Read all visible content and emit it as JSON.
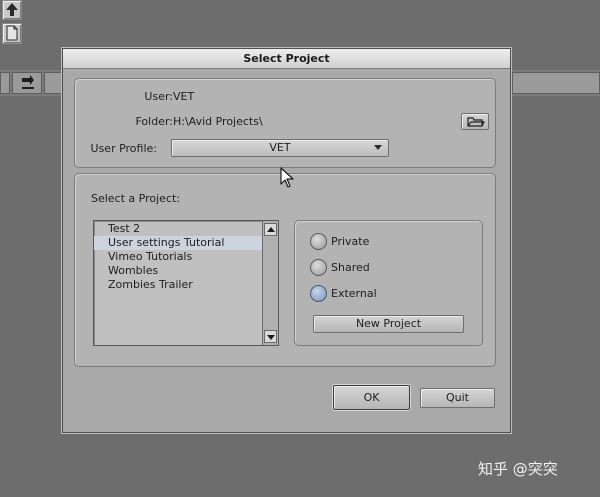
{
  "dialog": {
    "title": "Select Project",
    "user_label": "User:",
    "user_value": "VET",
    "folder_label": "Folder:",
    "folder_value": "H:\\Avid Projects\\",
    "user_profile_label": "User Profile:",
    "user_profile_value": "VET",
    "select_project_label": "Select a Project:",
    "projects": [
      {
        "label": "Test 2",
        "selected": false
      },
      {
        "label": "User settings Tutorial",
        "selected": true
      },
      {
        "label": "Vimeo Tutorials",
        "selected": false
      },
      {
        "label": "Wombles",
        "selected": false
      },
      {
        "label": "Zombies Trailer",
        "selected": false
      }
    ],
    "radio_options": [
      {
        "label": "Private",
        "checked": false
      },
      {
        "label": "Shared",
        "checked": false
      },
      {
        "label": "External",
        "checked": true
      }
    ],
    "new_project_label": "New Project",
    "ok_label": "OK",
    "quit_label": "Quit"
  },
  "watermark": "知乎 @突突",
  "colors": {
    "background": "#6d6d6d",
    "dialog": "#a9a9a9",
    "selection": "#cdd4df",
    "radio_checked": "#7e95b6"
  },
  "icons": [
    "up-arrow-icon",
    "document-icon",
    "folder-browse-icon",
    "arrow-cursor-icon",
    "down-arrow-icon"
  ]
}
